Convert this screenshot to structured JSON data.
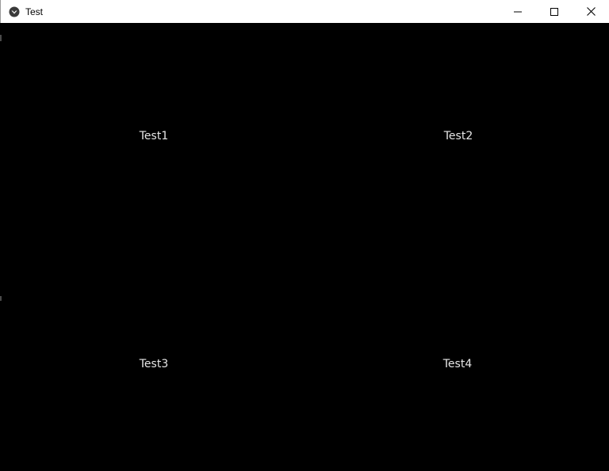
{
  "window": {
    "title": "Test",
    "icon": "kivy-app-icon",
    "controls": {
      "minimize_icon": "minimize-icon",
      "maximize_icon": "maximize-icon",
      "close_icon": "close-icon"
    }
  },
  "grid": {
    "cells": [
      {
        "label": "Test1"
      },
      {
        "label": "Test2"
      },
      {
        "label": "Test3"
      },
      {
        "label": "Test4"
      }
    ]
  },
  "colors": {
    "background": "#000000",
    "label": "#e6e6e6",
    "titlebar": "#ffffff"
  }
}
